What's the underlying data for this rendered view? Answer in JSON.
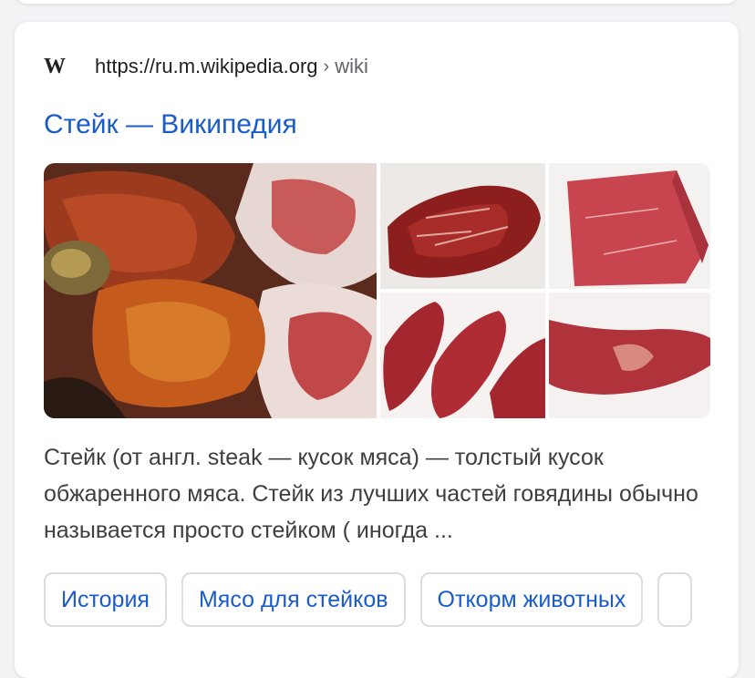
{
  "result": {
    "site_icon": "wikipedia-w-icon",
    "site_logo_text": "W",
    "url": "https://ru.m.wikipedia.org",
    "url_separator": "›",
    "url_path": "wiki",
    "title": "Стейк — Википедия",
    "snippet": "Стейк (от англ. steak — кусок мяса) — толстый кусок обжаренного мяса. Стейк из лучших частей говядины обычно называется просто стейком ( иногда ...",
    "images": [
      "steak-pile-image",
      "marbled-steak-image",
      "beef-block-image",
      "sliced-steak-image",
      "steak-cut-image"
    ],
    "chips": [
      "История",
      "Мясо для стейков",
      "Откорм животных"
    ]
  },
  "colors": {
    "link": "#1a5cc8",
    "text": "#3c4043",
    "url_path": "#5f6368",
    "background": "#f1f3f4",
    "chip_border": "#dadce0"
  }
}
